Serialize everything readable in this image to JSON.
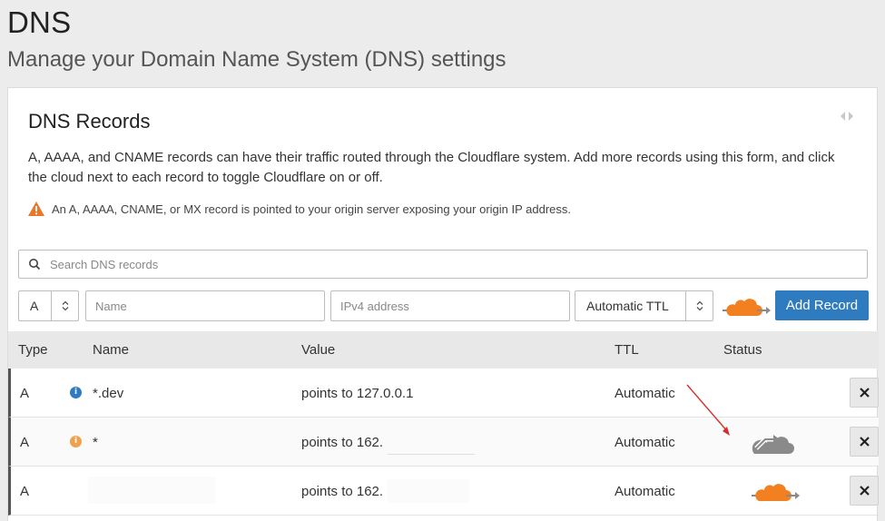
{
  "header": {
    "title": "DNS",
    "subtitle": "Manage your Domain Name System (DNS) settings"
  },
  "card": {
    "title": "DNS Records",
    "description": "A, AAAA, and CNAME records can have their traffic routed through the Cloudflare system. Add more records using this form, and click the cloud next to each record to toggle Cloudflare on or off.",
    "warning": "An A, AAAA, CNAME, or MX record is pointed to your origin server exposing your origin IP address."
  },
  "search": {
    "placeholder": "Search DNS records"
  },
  "form": {
    "type_value": "A",
    "name_placeholder": "Name",
    "value_placeholder": "IPv4 address",
    "ttl_value": "Automatic TTL",
    "add_label": "Add Record"
  },
  "table": {
    "columns": {
      "type": "Type",
      "name": "Name",
      "value": "Value",
      "ttl": "TTL",
      "status": "Status"
    },
    "rows": [
      {
        "type": "A",
        "name": "*.dev",
        "value": "points to 127.0.0.1",
        "ttl": "Automatic",
        "status": "none",
        "info_color": "#2f7bbf"
      },
      {
        "type": "A",
        "name": "*",
        "value": "points to 162.",
        "ttl": "Automatic",
        "status": "dns-only",
        "info_color": "#f0a150"
      },
      {
        "type": "A",
        "name": "",
        "value": "points to 162.",
        "ttl": "Automatic",
        "status": "proxied"
      }
    ]
  },
  "colors": {
    "accent": "#2f7bbf",
    "cloud_orange": "#f38020",
    "cloud_grey": "#8a8a8a",
    "warning": "#e8762b",
    "annotation": "#d32f2f"
  }
}
